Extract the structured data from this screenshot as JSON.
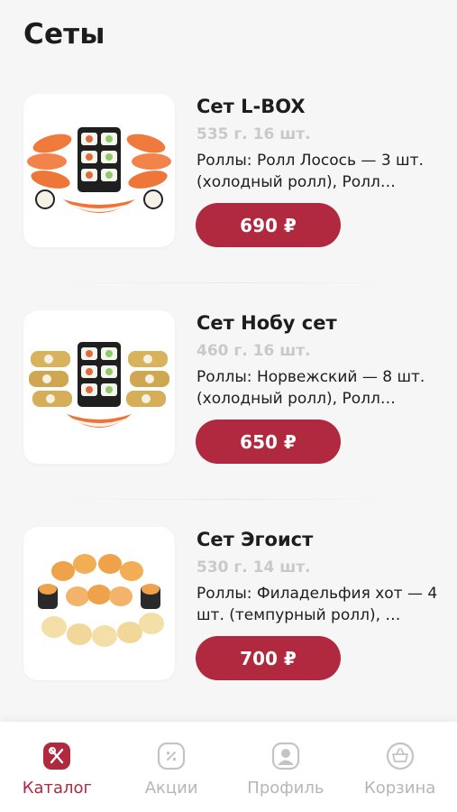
{
  "page": {
    "title": "Сеты"
  },
  "products": [
    {
      "name": "Сет L-BOX",
      "meta": "535 г. 16 шт.",
      "description": "Роллы: Ролл Лосось — 3 шт. (холодный ролл), Ролл…",
      "price": "690 ₽",
      "image_icon": "sushi-set-salmon-icon"
    },
    {
      "name": "Сет Нобу сет",
      "meta": "460 г. 16 шт.",
      "description": "Роллы: Норвежский — 8 шт. (холодный ролл), Ролл…",
      "price": "650 ₽",
      "image_icon": "sushi-set-tempura-icon"
    },
    {
      "name": "Сет Эгоист",
      "meta": "530 г. 14 шт.",
      "description": "Роллы: Филадельфия хот — 4 шт. (темпурный ролл), …",
      "price": "700 ₽",
      "image_icon": "sushi-set-baked-icon"
    }
  ],
  "bottom_nav": {
    "items": [
      {
        "label": "Каталог",
        "icon": "catalog-icon",
        "active": true
      },
      {
        "label": "Акции",
        "icon": "percent-icon",
        "active": false
      },
      {
        "label": "Профиль",
        "icon": "profile-icon",
        "active": false
      },
      {
        "label": "Корзина",
        "icon": "basket-icon",
        "active": false
      }
    ]
  },
  "colors": {
    "accent": "#b0293f",
    "inactive": "#b6b6b6",
    "meta_text": "#c9c9c9",
    "background": "#f6f6f6"
  }
}
